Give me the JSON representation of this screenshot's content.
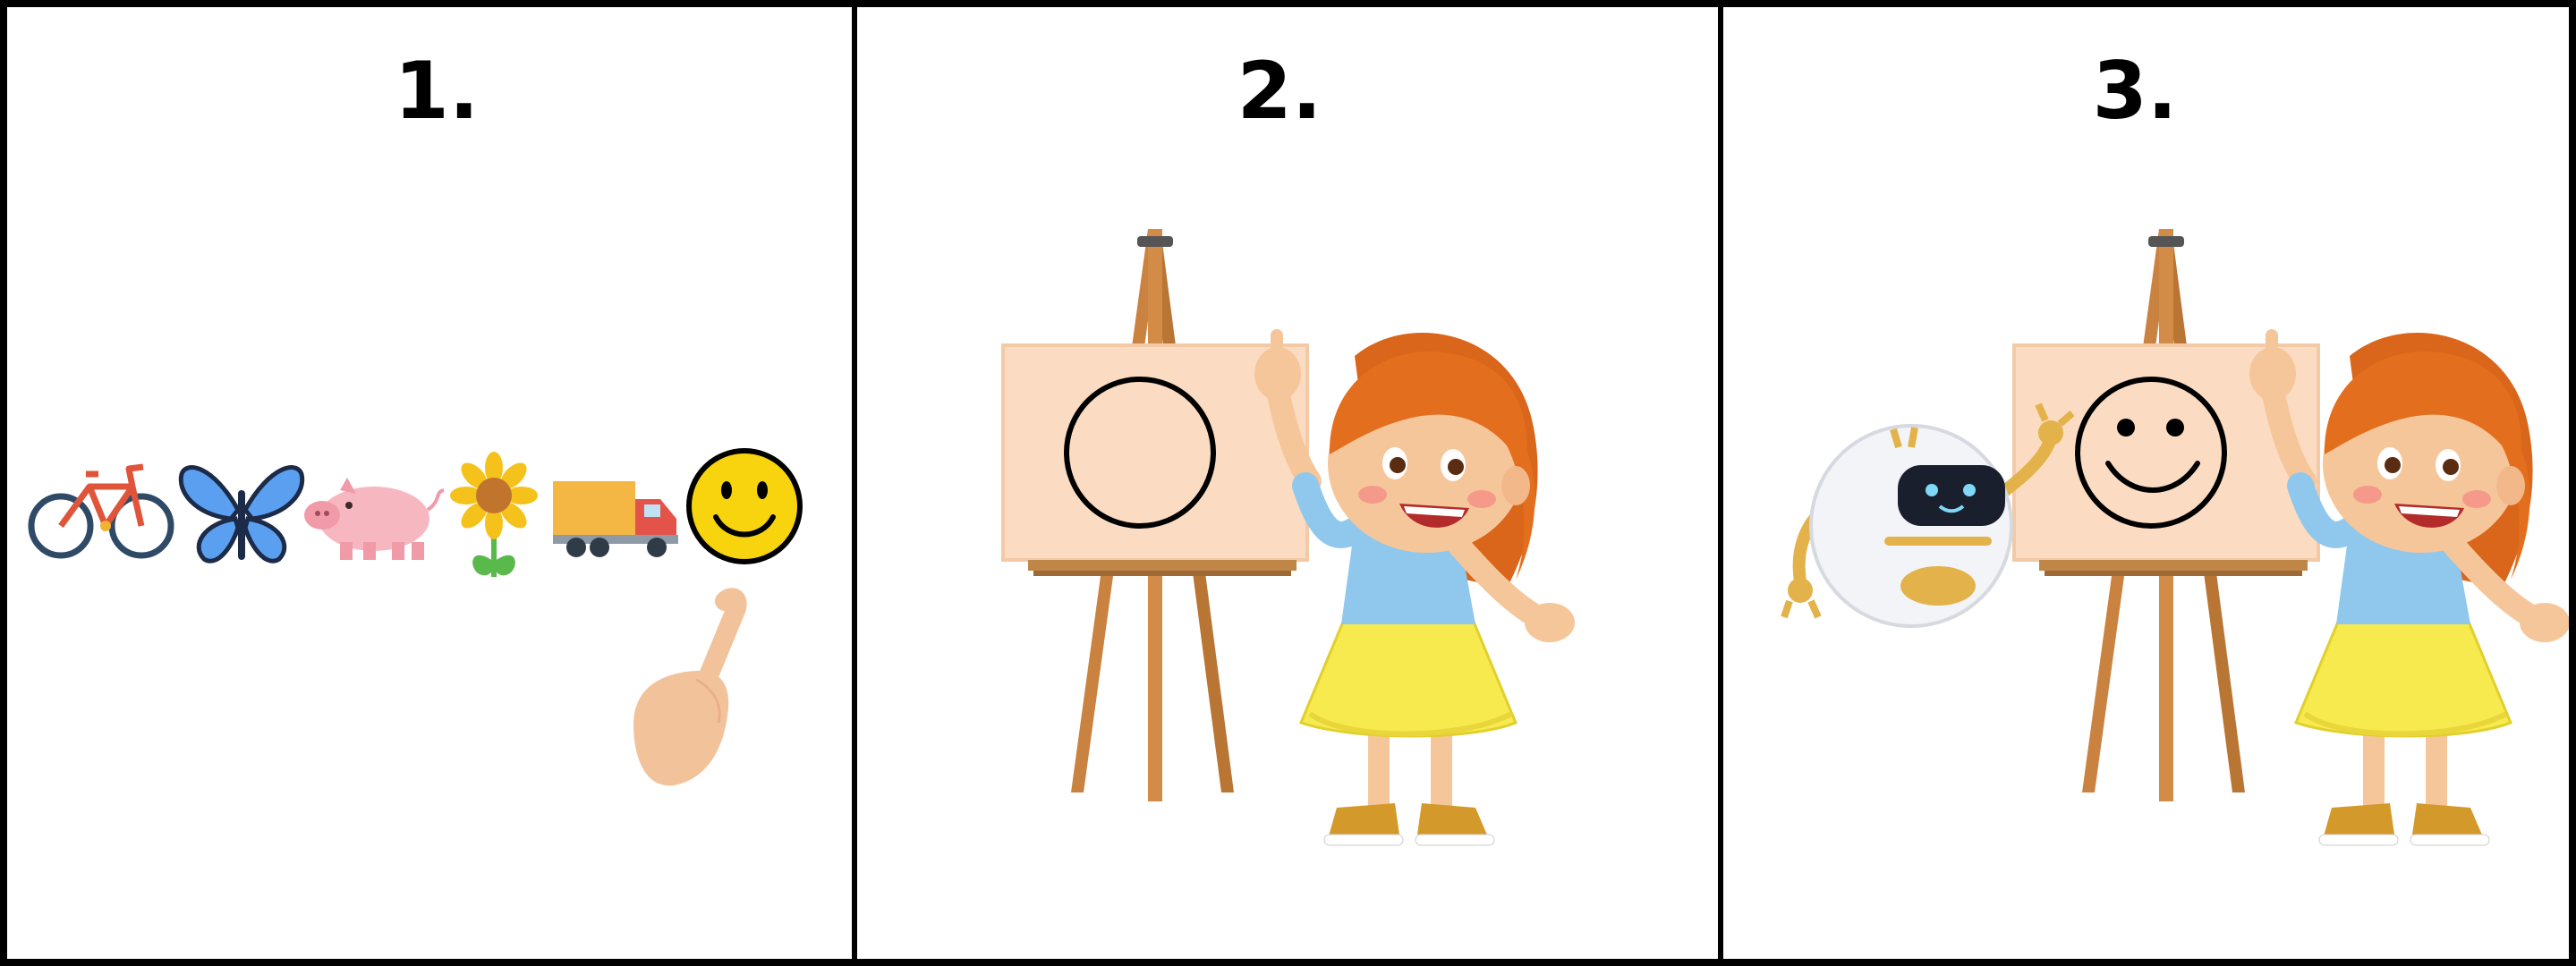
{
  "steps": [
    {
      "number": "1.",
      "caption": ""
    },
    {
      "number": "2.",
      "caption": ""
    },
    {
      "number": "3.",
      "caption": ""
    }
  ],
  "panel1": {
    "icons": [
      "bicycle-icon",
      "butterfly-icon",
      "pig-icon",
      "sunflower-icon",
      "delivery-truck-icon",
      "smiling-face-icon"
    ],
    "pointer": "pointing-hand-icon"
  },
  "panel2": {
    "easel_drawing": "circle",
    "character": "girl"
  },
  "panel3": {
    "easel_drawing": "smiley-face",
    "characters": [
      "robot",
      "girl"
    ]
  },
  "colors": {
    "border": "#000000",
    "canvas": "#fbdcc2",
    "easel_wood": "#c9823f",
    "emoji_yellow": "#f7d40e",
    "girl_hair": "#e36f1e",
    "girl_shirt": "#8fc8ec",
    "girl_skirt": "#f6ea4f"
  }
}
